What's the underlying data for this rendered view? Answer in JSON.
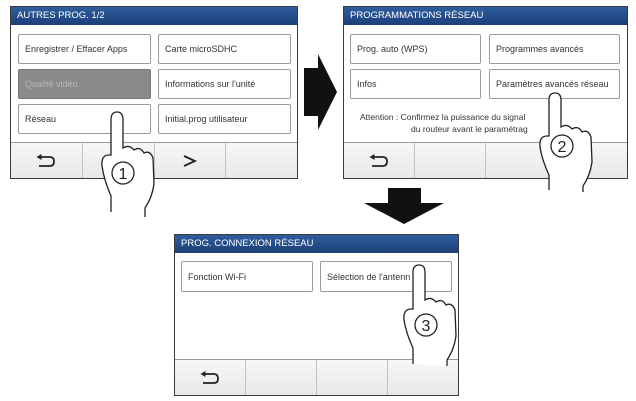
{
  "screen1": {
    "title": "AUTRES PROG. 1/2",
    "buttons": [
      "Enregistrer / Effacer Apps",
      "Carte microSDHC",
      "Qualité vidéo",
      "Informations sur l'unité",
      "Réseau",
      "Initial.prog utilisateur"
    ],
    "disabled_button": "Qualité vidéo",
    "nav": {
      "back_icon": "return-arrow-icon",
      "next_label": ">"
    }
  },
  "screen2": {
    "title": "PROGRAMMATIONS RÉSEAU",
    "buttons": [
      "Prog. auto (WPS)",
      "Programmes avancés",
      "Infos",
      "Paramètres avancés réseau"
    ],
    "note_line1": "Attention : Confirmez la puissance du signal",
    "note_line2": "du routeur avant le paramétrag",
    "nav": {
      "back_icon": "return-arrow-icon"
    }
  },
  "screen3": {
    "title": "PROG. CONNEXION RÉSEAU",
    "buttons": [
      "Fonction Wi-Fi",
      "Sélection de l'antenn"
    ],
    "nav": {
      "back_icon": "return-arrow-icon"
    }
  },
  "steps": [
    "1",
    "2",
    "3"
  ],
  "colors": {
    "titlebar": "#2f5d9e",
    "disabled": "#8a8a8a",
    "arrow": "#111111"
  }
}
